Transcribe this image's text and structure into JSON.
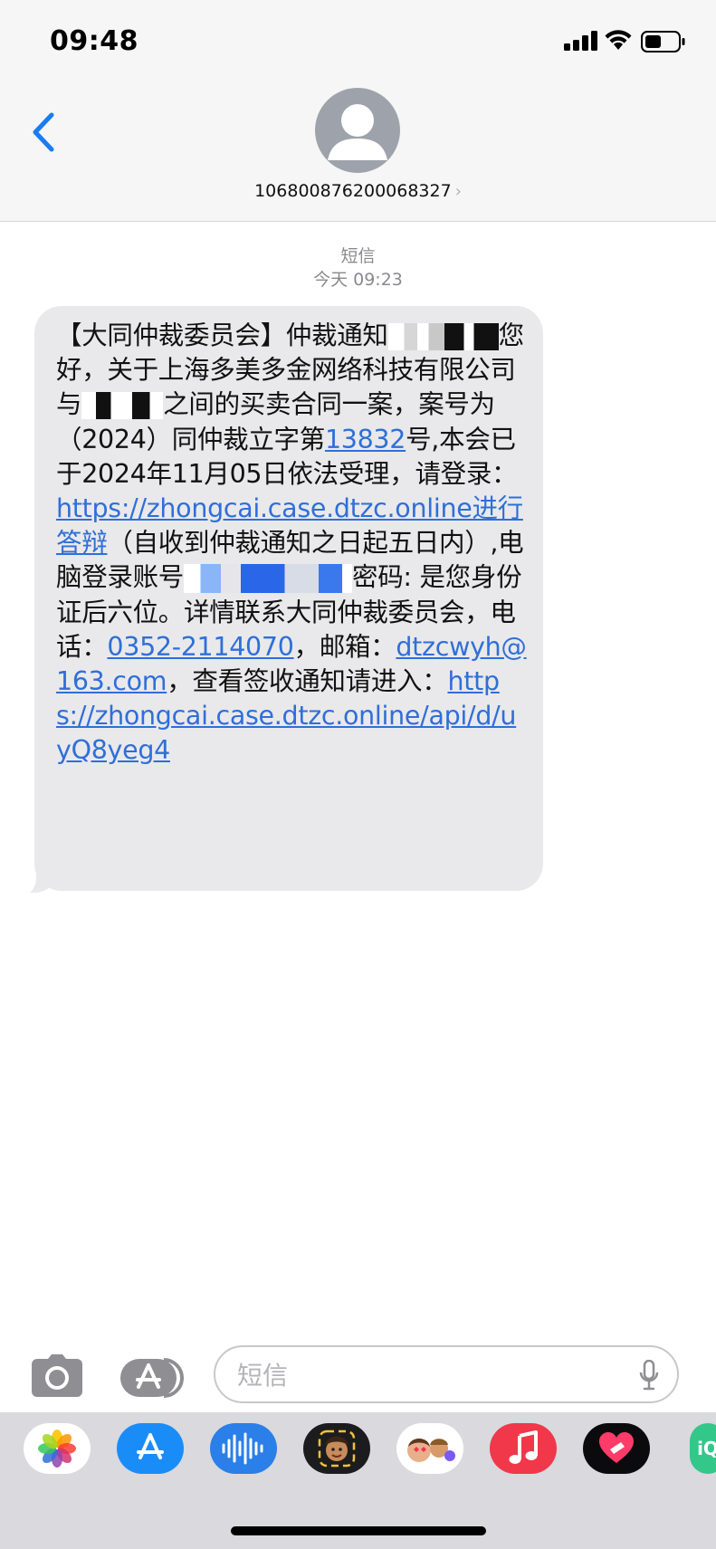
{
  "status_bar": {
    "time": "09:48"
  },
  "contact": {
    "number": "106800876200068327"
  },
  "conversation": {
    "service_label": "短信",
    "timestamp": "今天 09:23"
  },
  "message": {
    "p1": "【大同仲裁委员会】仲裁通知",
    "p2": "您好，关于上海多美多金网络科技有限公司与",
    "p3": "之间的买卖合同一案，案号为（2024）同仲裁立字第",
    "case_no": "13832",
    "p4": "号,本会已于2024年11月05日依法受理，请登录：",
    "url1": "https://zhongcai.case.dtzc.online进行答辩",
    "p5": "（自收到仲裁通知之日起五日内）,电脑登录账号",
    "p6": "密码: 是您身份证后六位。详情联系大同仲裁委员会，电话：",
    "phone": "0352-2114070",
    "p7": "，邮箱：",
    "email": "dtzcwyh@163.com",
    "p8": "，查看签收通知请进入：",
    "url2": "https://zhongcai.case.dtzc.online/api/d/uyQ8yeg4"
  },
  "compose": {
    "placeholder": "短信"
  },
  "drawer_apps": [
    "photos",
    "app-store",
    "audio-message",
    "memoji",
    "memoji-stickers",
    "music",
    "digital-touch",
    "more"
  ],
  "colors": {
    "link": "#2f6fd8",
    "ios_blue": "#1a7cf3",
    "bubble": "#e9e9eb"
  }
}
